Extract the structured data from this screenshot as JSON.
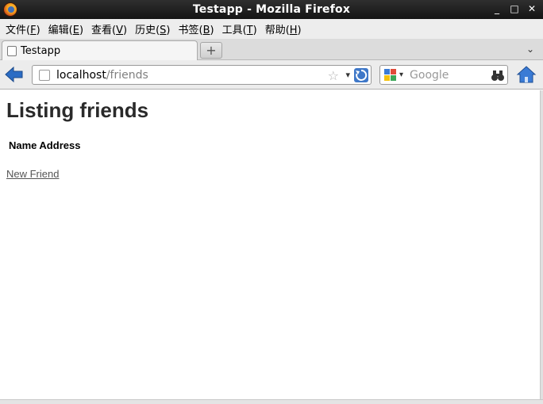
{
  "window": {
    "title": "Testapp - Mozilla Firefox",
    "controls": {
      "minimize": "_",
      "maximize": "□",
      "close": "✕"
    }
  },
  "menubar": {
    "items": [
      {
        "text": "文件(",
        "key": "F",
        "end": ")"
      },
      {
        "text": "编辑(",
        "key": "E",
        "end": ")"
      },
      {
        "text": "查看(",
        "key": "V",
        "end": ")"
      },
      {
        "text": "历史(",
        "key": "S",
        "end": ")"
      },
      {
        "text": "书签(",
        "key": "B",
        "end": ")"
      },
      {
        "text": "工具(",
        "key": "T",
        "end": ")"
      },
      {
        "text": "帮助(",
        "key": "H",
        "end": ")"
      }
    ]
  },
  "tabs": {
    "active": {
      "label": "Testapp"
    },
    "new_tab_symbol": "+",
    "list_symbol": "⌄"
  },
  "navigation": {
    "url_host": "localhost",
    "url_path": "/friends",
    "star_symbol": "☆",
    "dropdown_symbol": "▾",
    "search_placeholder": "Google",
    "search_engine_icon": "google-icon",
    "colors": {
      "back_arrow": "#2b6cc4",
      "home": "#3a7bd5"
    }
  },
  "page": {
    "heading": "Listing friends",
    "columns": [
      "Name",
      "Address"
    ],
    "new_link": "New Friend"
  }
}
